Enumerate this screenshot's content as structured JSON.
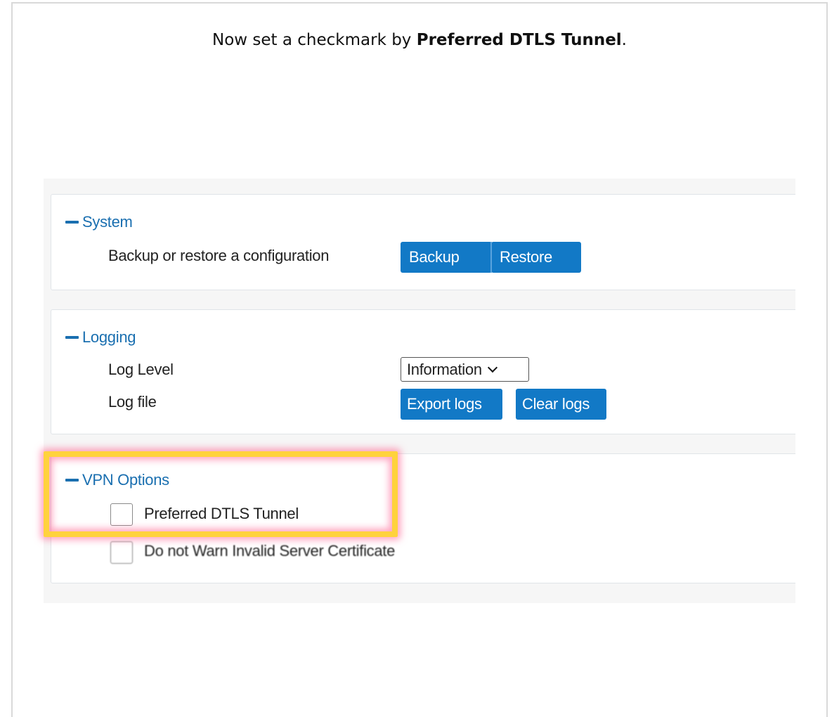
{
  "instruction": {
    "prefix": "Now set a checkmark by ",
    "emphasis": "Preferred DTLS Tunnel",
    "suffix": "."
  },
  "system": {
    "title": "System",
    "row_label": "Backup or restore a configuration",
    "backup_label": "Backup",
    "restore_label": "Restore"
  },
  "logging": {
    "title": "Logging",
    "log_level_label": "Log Level",
    "log_level_value": "Information",
    "log_file_label": "Log file",
    "export_label": "Export logs",
    "clear_label": "Clear logs"
  },
  "vpn": {
    "title": "VPN Options",
    "options": [
      {
        "label": "Preferred DTLS Tunnel",
        "checked": false
      },
      {
        "label": "Do not Warn Invalid Server Certificate",
        "checked": false
      }
    ]
  },
  "colors": {
    "accent": "#1279c6",
    "header_text": "#1a6fb0",
    "highlight_border": "#ffd23d",
    "highlight_glow": "#ff5a8c"
  },
  "icons": {
    "collapse": "minus-icon",
    "dropdown": "chevron-down-icon"
  }
}
